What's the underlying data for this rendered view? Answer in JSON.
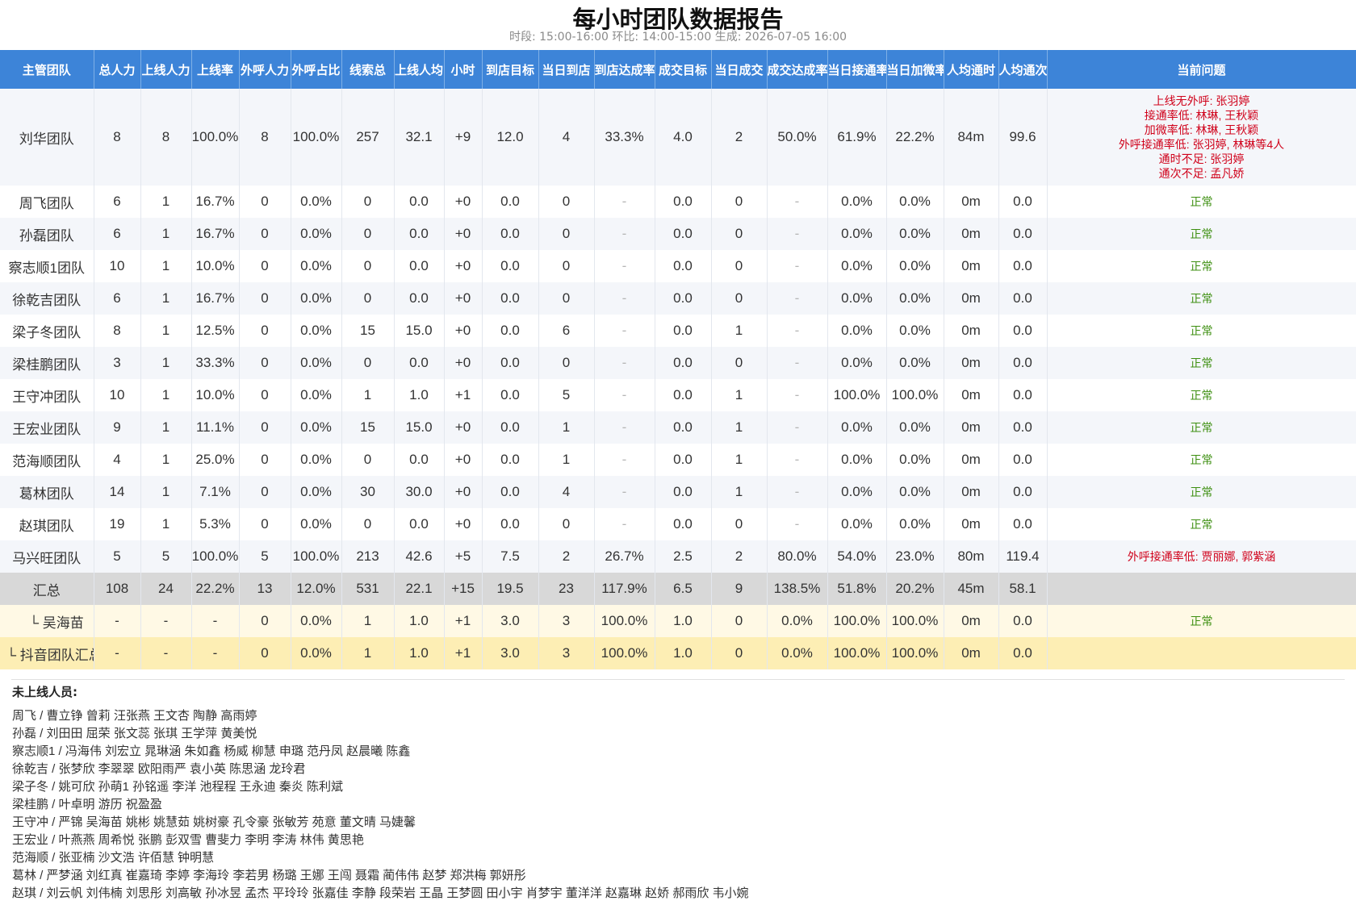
{
  "title": "每小时团队数据报告",
  "subtitle": "时段: 15:00-16:00   环比: 14:00-15:00   生成: 2026-07-05 16:00",
  "columns": [
    "主管团队",
    "总人力",
    "上线人力",
    "上线率",
    "外呼人力",
    "外呼占比",
    "线索总",
    "上线人均",
    "小时",
    "到店目标",
    "当日到店",
    "到店达成率",
    "成交目标",
    "当日成交",
    "成交达成率",
    "当日接通率",
    "当日加微率",
    "人均通时",
    "人均通次",
    "当前问题"
  ],
  "rows": [
    {
      "type": "team",
      "cells": [
        "刘华团队",
        "8",
        "8",
        "100.0%",
        "8",
        "100.0%",
        "257",
        "32.1",
        "+9",
        "12.0",
        "4",
        "33.3%",
        "4.0",
        "2",
        "50.0%",
        "61.9%",
        "22.2%",
        "84m",
        "99.6"
      ],
      "issues": [
        "上线无外呼: 张羽婷",
        "接通率低: 林琳, 王秋颖",
        "加微率低: 林琳, 王秋颖",
        "外呼接通率低: 张羽婷, 林琳等4人",
        "通时不足: 张羽婷",
        "通次不足: 孟凡娇"
      ],
      "status": "red"
    },
    {
      "type": "team",
      "cells": [
        "周飞团队",
        "6",
        "1",
        "16.7%",
        "0",
        "0.0%",
        "0",
        "0.0",
        "+0",
        "0.0",
        "0",
        "-",
        "0.0",
        "0",
        "-",
        "0.0%",
        "0.0%",
        "0m",
        "0.0"
      ],
      "issues": [
        "正常"
      ],
      "status": "green"
    },
    {
      "type": "team",
      "cells": [
        "孙磊团队",
        "6",
        "1",
        "16.7%",
        "0",
        "0.0%",
        "0",
        "0.0",
        "+0",
        "0.0",
        "0",
        "-",
        "0.0",
        "0",
        "-",
        "0.0%",
        "0.0%",
        "0m",
        "0.0"
      ],
      "issues": [
        "正常"
      ],
      "status": "green"
    },
    {
      "type": "team",
      "cells": [
        "察志顺1团队",
        "10",
        "1",
        "10.0%",
        "0",
        "0.0%",
        "0",
        "0.0",
        "+0",
        "0.0",
        "0",
        "-",
        "0.0",
        "0",
        "-",
        "0.0%",
        "0.0%",
        "0m",
        "0.0"
      ],
      "issues": [
        "正常"
      ],
      "status": "green"
    },
    {
      "type": "team",
      "cells": [
        "徐乾吉团队",
        "6",
        "1",
        "16.7%",
        "0",
        "0.0%",
        "0",
        "0.0",
        "+0",
        "0.0",
        "0",
        "-",
        "0.0",
        "0",
        "-",
        "0.0%",
        "0.0%",
        "0m",
        "0.0"
      ],
      "issues": [
        "正常"
      ],
      "status": "green"
    },
    {
      "type": "team",
      "cells": [
        "梁子冬团队",
        "8",
        "1",
        "12.5%",
        "0",
        "0.0%",
        "15",
        "15.0",
        "+0",
        "0.0",
        "6",
        "-",
        "0.0",
        "1",
        "-",
        "0.0%",
        "0.0%",
        "0m",
        "0.0"
      ],
      "issues": [
        "正常"
      ],
      "status": "green"
    },
    {
      "type": "team",
      "cells": [
        "梁桂鹏团队",
        "3",
        "1",
        "33.3%",
        "0",
        "0.0%",
        "0",
        "0.0",
        "+0",
        "0.0",
        "0",
        "-",
        "0.0",
        "0",
        "-",
        "0.0%",
        "0.0%",
        "0m",
        "0.0"
      ],
      "issues": [
        "正常"
      ],
      "status": "green"
    },
    {
      "type": "team",
      "cells": [
        "王守冲团队",
        "10",
        "1",
        "10.0%",
        "0",
        "0.0%",
        "1",
        "1.0",
        "+1",
        "0.0",
        "5",
        "-",
        "0.0",
        "1",
        "-",
        "100.0%",
        "100.0%",
        "0m",
        "0.0"
      ],
      "issues": [
        "正常"
      ],
      "status": "green"
    },
    {
      "type": "team",
      "cells": [
        "王宏业团队",
        "9",
        "1",
        "11.1%",
        "0",
        "0.0%",
        "15",
        "15.0",
        "+0",
        "0.0",
        "1",
        "-",
        "0.0",
        "1",
        "-",
        "0.0%",
        "0.0%",
        "0m",
        "0.0"
      ],
      "issues": [
        "正常"
      ],
      "status": "green"
    },
    {
      "type": "team",
      "cells": [
        "范海顺团队",
        "4",
        "1",
        "25.0%",
        "0",
        "0.0%",
        "0",
        "0.0",
        "+0",
        "0.0",
        "1",
        "-",
        "0.0",
        "1",
        "-",
        "0.0%",
        "0.0%",
        "0m",
        "0.0"
      ],
      "issues": [
        "正常"
      ],
      "status": "green"
    },
    {
      "type": "team",
      "cells": [
        "葛林团队",
        "14",
        "1",
        "7.1%",
        "0",
        "0.0%",
        "30",
        "30.0",
        "+0",
        "0.0",
        "4",
        "-",
        "0.0",
        "1",
        "-",
        "0.0%",
        "0.0%",
        "0m",
        "0.0"
      ],
      "issues": [
        "正常"
      ],
      "status": "green"
    },
    {
      "type": "team",
      "cells": [
        "赵琪团队",
        "19",
        "1",
        "5.3%",
        "0",
        "0.0%",
        "0",
        "0.0",
        "+0",
        "0.0",
        "0",
        "-",
        "0.0",
        "0",
        "-",
        "0.0%",
        "0.0%",
        "0m",
        "0.0"
      ],
      "issues": [
        "正常"
      ],
      "status": "green"
    },
    {
      "type": "team",
      "cells": [
        "马兴旺团队",
        "5",
        "5",
        "100.0%",
        "5",
        "100.0%",
        "213",
        "42.6",
        "+5",
        "7.5",
        "2",
        "26.7%",
        "2.5",
        "2",
        "80.0%",
        "54.0%",
        "23.0%",
        "80m",
        "119.4"
      ],
      "issues": [
        "外呼接通率低: 贾丽娜, 郭紫涵"
      ],
      "status": "red"
    },
    {
      "type": "total",
      "cells": [
        "汇总",
        "108",
        "24",
        "22.2%",
        "13",
        "12.0%",
        "531",
        "22.1",
        "+15",
        "19.5",
        "23",
        "117.9%",
        "6.5",
        "9",
        "138.5%",
        "51.8%",
        "20.2%",
        "45m",
        "58.1"
      ],
      "issues": [
        ""
      ],
      "status": "none"
    },
    {
      "type": "sub",
      "cells": [
        "└ 吴海苗",
        "-",
        "-",
        "-",
        "0",
        "0.0%",
        "1",
        "1.0",
        "+1",
        "3.0",
        "3",
        "100.0%",
        "1.0",
        "0",
        "0.0%",
        "100.0%",
        "100.0%",
        "0m",
        "0.0"
      ],
      "issues": [
        "正常"
      ],
      "status": "green"
    },
    {
      "type": "douyin",
      "cells": [
        "└ 抖音团队汇总",
        "-",
        "-",
        "-",
        "0",
        "0.0%",
        "1",
        "1.0",
        "+1",
        "3.0",
        "3",
        "100.0%",
        "1.0",
        "0",
        "0.0%",
        "100.0%",
        "100.0%",
        "0m",
        "0.0"
      ],
      "issues": [
        ""
      ],
      "status": "none"
    }
  ],
  "offline_title": "未上线人员:",
  "offline_lines": [
    "周飞 / 曹立铮 曾莉 汪张燕 王文杏 陶静 高雨婷",
    "孙磊 / 刘田田 屈荣 张文蕊 张琪 王学萍 黄美悦",
    "察志顺1 / 冯海伟 刘宏立 晁琳涵 朱如鑫 杨威 柳慧 申璐 范丹凤 赵晨曦 陈鑫",
    "徐乾吉 / 张梦欣 李翠翠 欧阳雨严 袁小英 陈思涵 龙玲君",
    "梁子冬 / 姚可欣 孙萌1 孙铭遥 李洋 池程程 王永迪 秦炎 陈利斌",
    "梁桂鹏 / 叶卓明 游历 祝盈盈",
    "王守冲 / 严锦 吴海苗 姚彬 姚慧茹 姚树豪 孔令豪 张敏芳 苑意 董文晴 马婕馨",
    "王宏业 / 叶燕燕 周希悦 张鹏 彭双雪 曹斐力 李明 李涛 林伟 黄思艳",
    "范海顺 / 张亚楠 沙文浩 许佰慧 钟明慧",
    "葛林 / 严梦涵 刘红真 崔嘉琦 李婷 李海玲 李若男 杨璐 王娜 王闯 聂霜 蔺伟伟 赵梦 郑洪梅 郭妍彤",
    "赵琪 / 刘云帆 刘伟楠 刘思彤 刘高敏 孙冰昱 孟杰 平玲玲 张嘉佳 李静 段荣岩 王晶 王梦圆 田小宇 肖梦宇 董洋洋 赵嘉琳 赵娇 郝雨欣 韦小婉"
  ]
}
